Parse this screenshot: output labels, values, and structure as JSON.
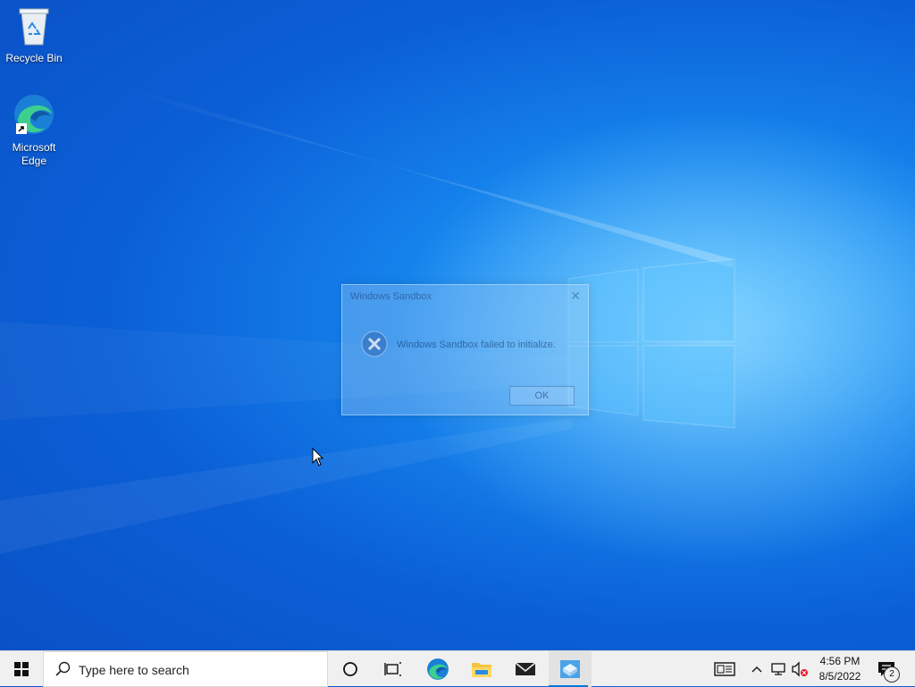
{
  "desktop": {
    "icons": [
      {
        "label": "Recycle Bin",
        "icon": "recycle-bin-icon"
      },
      {
        "label": "Microsoft Edge",
        "icon": "edge-icon"
      }
    ]
  },
  "dialog": {
    "title": "Windows Sandbox",
    "message": "Windows Sandbox failed to initialize.",
    "ok_label": "OK",
    "icon": "error-icon"
  },
  "taskbar": {
    "search_placeholder": "Type here to search",
    "apps": [
      "cortana-icon",
      "task-view-icon",
      "edge-icon",
      "file-explorer-icon",
      "mail-icon",
      "windows-sandbox-icon"
    ],
    "active_app": "windows-sandbox-icon",
    "tray": {
      "time": "4:56 PM",
      "date": "8/5/2022",
      "notification_count": "2"
    }
  },
  "colors": {
    "accent": "#0078d7",
    "wallpaper": "#1686ee",
    "taskbar": "#f0f0f0"
  }
}
